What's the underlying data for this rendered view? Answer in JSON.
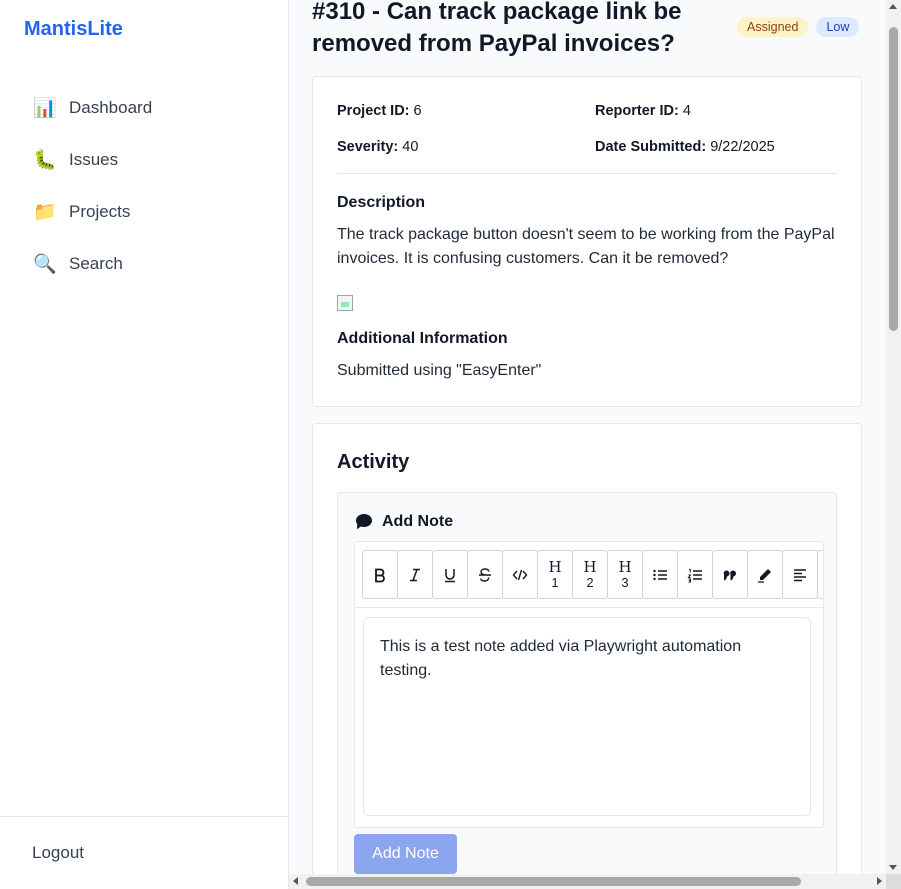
{
  "app": {
    "brand": "MantisLite"
  },
  "sidebar": {
    "items": [
      {
        "icon": "📊",
        "icon_name": "bar-chart-icon",
        "label": "Dashboard"
      },
      {
        "icon": "🐛",
        "icon_name": "bug-icon",
        "label": "Issues"
      },
      {
        "icon": "📁",
        "icon_name": "folder-icon",
        "label": "Projects"
      },
      {
        "icon": "🔍",
        "icon_name": "magnifier-icon",
        "label": "Search"
      }
    ],
    "logout_label": "Logout"
  },
  "issue": {
    "title": "#310 - Can track package link be removed from PayPal invoices?",
    "status": "Assigned",
    "priority": "Low",
    "project_id_label": "Project ID:",
    "project_id": "6",
    "reporter_id_label": "Reporter ID:",
    "reporter_id": "4",
    "severity_label": "Severity:",
    "severity": "40",
    "date_label": "Date Submitted:",
    "date": "9/22/2025",
    "description_heading": "Description",
    "description": "The track package button doesn't seem to be working from the PayPal invoices. It is confusing customers. Can it be removed?",
    "additional_heading": "Additional Information",
    "additional": "Submitted using \"EasyEnter\""
  },
  "activity": {
    "heading": "Activity",
    "add_note_heading": "Add Note",
    "toolbar": {
      "h1": "H",
      "h1_sub": "1",
      "h2": "H",
      "h2_sub": "2",
      "h3": "H",
      "h3_sub": "3"
    },
    "note_text": "This is a test note added via Playwright automation testing.",
    "add_note_button": "Add Note"
  },
  "colors": {
    "brand": "#2563eb",
    "status_badge_bg": "#fef3c7",
    "priority_badge_bg": "#dbeafe",
    "button_disabled": "#8ba5ee"
  }
}
